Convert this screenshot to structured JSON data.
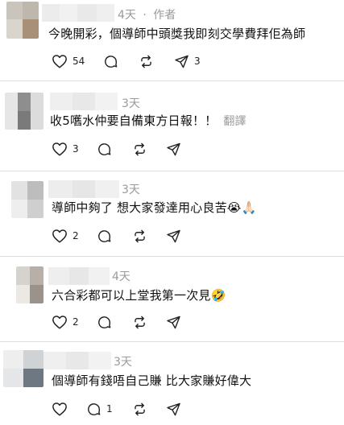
{
  "comments": [
    {
      "time": "4天",
      "author_tag": "作者",
      "separator": "·",
      "text": "今晚開彩，個導師中頭獎我即刻交學費拜佢為師",
      "likes": "54",
      "shares": "3",
      "translate": ""
    },
    {
      "time": "3天",
      "author_tag": "",
      "separator": "",
      "text": "收5嚿水仲要自備東方日報！！",
      "likes": "3",
      "shares": "",
      "translate": "翻譯"
    },
    {
      "time": "3天",
      "author_tag": "",
      "separator": "",
      "text": "導師中夠了 想大家發達用心良苦😭🙏🏻",
      "likes": "2",
      "shares": "",
      "translate": ""
    },
    {
      "time": "4天",
      "author_tag": "",
      "separator": "",
      "text": "六合彩都可以上堂我第一次見🤣",
      "likes": "2",
      "shares": "",
      "translate": ""
    },
    {
      "time": "3天",
      "author_tag": "",
      "separator": "",
      "text": "個導師有錢唔自己賺 比大家賺好偉大",
      "likes": "",
      "replies": "1",
      "shares": "",
      "translate": ""
    }
  ],
  "icons": {
    "like": "heart-icon",
    "reply": "comment-bubble-icon",
    "repost": "repost-icon",
    "share": "send-icon"
  },
  "colors": {
    "text": "#111111",
    "meta": "#9a9a9a",
    "divider": "#dedede"
  }
}
